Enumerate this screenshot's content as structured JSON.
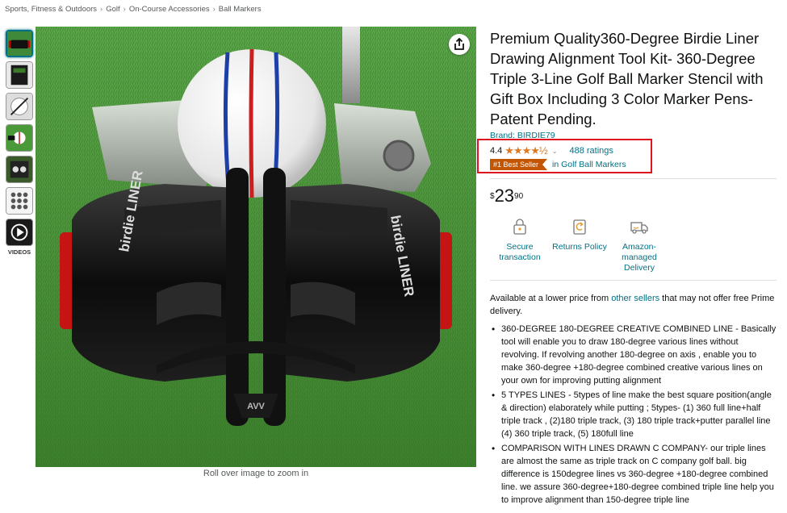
{
  "breadcrumb": {
    "items": [
      "Sports, Fitness & Outdoors",
      "Golf",
      "On-Course Accessories",
      "Ball Markers"
    ],
    "separator": "›"
  },
  "gallery": {
    "thumbnails": [
      "product-image-thumbnail",
      "box-thumbnail",
      "marker-lines-thumbnail",
      "ball-thumbnail",
      "kit-thumbnail",
      "grid-thumbnail",
      "video-thumbnail"
    ],
    "videos_label": "VIDEOS",
    "zoom_hint": "Roll over image to zoom in",
    "tool_text_left": "birdie LINER",
    "tool_text_right": "birdie LINER"
  },
  "product": {
    "title": "Premium Quality360-Degree Birdie Liner Drawing Alignment Tool Kit- 360-Degree Triple 3-Line Golf Ball Marker Stencil with Gift Box Including 3 Color Marker Pens-Patent Pending.",
    "brand": "Brand: BIRDIE79",
    "rating": "4.4",
    "stars": "★★★★½",
    "ratings_count": "488 ratings",
    "best_seller_badge": "#1 Best Seller",
    "best_seller_category": "in Golf Ball Markers",
    "price_symbol": "$",
    "price_whole": "23",
    "price_fraction": "90"
  },
  "features": [
    {
      "icon": "lock-icon",
      "label": "Secure transaction"
    },
    {
      "icon": "returns-icon",
      "label": "Returns Policy"
    },
    {
      "icon": "truck-icon",
      "label": "Amazon-managed Delivery"
    }
  ],
  "offer": {
    "prefix": "Available at a lower price from ",
    "link": "other sellers",
    "suffix": " that may not offer free Prime delivery."
  },
  "bullets": [
    "360-DEGREE 180-DEGREE CREATIVE COMBINED LINE - Basically tool will enable you to draw 180-degree various lines without revolving. If revolving another 180-degree on axis , enable you to make 360-degree +180-degree combined creative various lines on your own for improving putting alignment",
    "5 TYPES LINES - 5types of line make the best square position(angle & direction) elaborately while putting ; 5types- (1) 360 full line+half triple track , (2)180 triple track, (3) 180 triple track+putter parallel line (4) 360 triple track, (5) 180full line",
    "COMPARISON WITH LINES DRAWN C COMPANY- our triple lines are almost the same as triple track on C company golf ball. big difference is 150degree lines vs 360-degree +180-degree combined line. we assure 360-degree+180-degree combined triple line help you to improve alignment than 150-degree triple line"
  ],
  "colors": {
    "link": "#007185",
    "badge": "#c45500",
    "star": "#de7921",
    "highlight_box": "#e0141e"
  }
}
